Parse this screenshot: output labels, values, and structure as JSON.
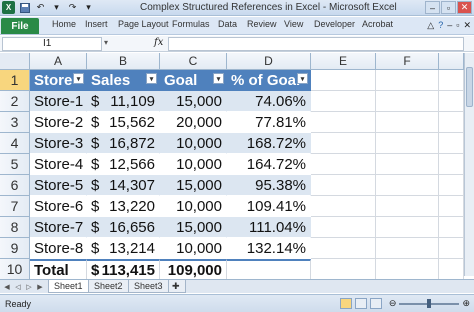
{
  "window": {
    "title": "Complex Structured References in Excel - Microsoft Excel",
    "app_logo": "X"
  },
  "ribbon": {
    "tabs": [
      "File",
      "Home",
      "Insert",
      "Page Layout",
      "Formulas",
      "Data",
      "Review",
      "View",
      "Developer",
      "Acrobat"
    ]
  },
  "formula_bar": {
    "name_box": "I1",
    "fx_label": "fx",
    "formula": ""
  },
  "grid": {
    "columns": [
      "A",
      "B",
      "C",
      "D",
      "E",
      "F"
    ],
    "rows": [
      "1",
      "2",
      "3",
      "4",
      "5",
      "6",
      "7",
      "8",
      "9",
      "10"
    ],
    "selected_row": "1",
    "table": {
      "headers": [
        "Store",
        "Sales",
        "Goal",
        "% of Goal"
      ],
      "rows": [
        {
          "store": "Store-1",
          "currency": "$",
          "sales": "11,109",
          "goal": "15,000",
          "pct": "74.06%"
        },
        {
          "store": "Store-2",
          "currency": "$",
          "sales": "15,562",
          "goal": "20,000",
          "pct": "77.81%"
        },
        {
          "store": "Store-3",
          "currency": "$",
          "sales": "16,872",
          "goal": "10,000",
          "pct": "168.72%"
        },
        {
          "store": "Store-4",
          "currency": "$",
          "sales": "12,566",
          "goal": "10,000",
          "pct": "164.72%"
        },
        {
          "store": "Store-5",
          "currency": "$",
          "sales": "14,307",
          "goal": "15,000",
          "pct": "95.38%"
        },
        {
          "store": "Store-6",
          "currency": "$",
          "sales": "13,220",
          "goal": "10,000",
          "pct": "109.41%"
        },
        {
          "store": "Store-7",
          "currency": "$",
          "sales": "16,656",
          "goal": "15,000",
          "pct": "111.04%"
        },
        {
          "store": "Store-8",
          "currency": "$",
          "sales": "13,214",
          "goal": "10,000",
          "pct": "132.14%"
        }
      ],
      "total": {
        "label": "Total",
        "currency": "$",
        "sales": "113,415",
        "goal": "109,000",
        "pct": ""
      }
    }
  },
  "sheets": {
    "tabs": [
      "Sheet1",
      "Sheet2",
      "Sheet3"
    ],
    "active": "Sheet1"
  },
  "status": {
    "text": "Ready"
  },
  "colors": {
    "table_header": "#4f81bd",
    "band": "#dce6f1",
    "file_tab": "#2a8a47"
  }
}
